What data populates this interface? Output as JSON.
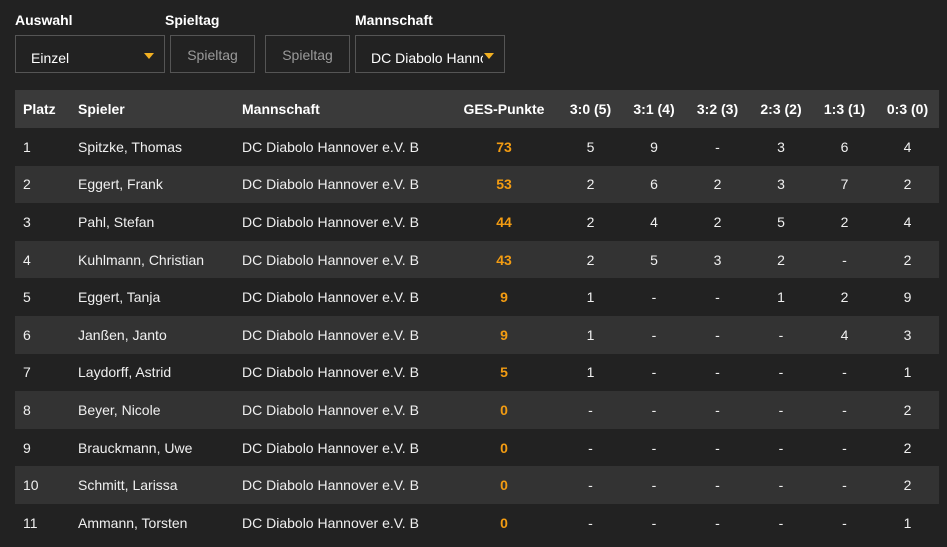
{
  "filters": {
    "auswahl_label": "Auswahl",
    "auswahl_value": "Einzel",
    "spieltag_label": "Spieltag",
    "spieltag_btn1": "Spieltag",
    "spieltag_btn2": "Spieltag",
    "mannschaft_label": "Mannschaft",
    "mannschaft_value": "DC Diabolo Hannover e.V. B"
  },
  "colors": {
    "accent": "#f39c12",
    "caret": "#f2b022",
    "header_bg": "#3a3a3a",
    "row_alt": "#333333",
    "bg": "#222222"
  },
  "table": {
    "headers": [
      "Platz",
      "Spieler",
      "Mannschaft",
      "GES-Punkte",
      "3:0 (5)",
      "3:1 (4)",
      "3:2 (3)",
      "2:3 (2)",
      "1:3 (1)",
      "0:3 (0)"
    ],
    "rows": [
      [
        "1",
        "Spitzke, Thomas",
        "DC Diabolo Hannover e.V. B",
        "73",
        "5",
        "9",
        "-",
        "3",
        "6",
        "4"
      ],
      [
        "2",
        "Eggert, Frank",
        "DC Diabolo Hannover e.V. B",
        "53",
        "2",
        "6",
        "2",
        "3",
        "7",
        "2"
      ],
      [
        "3",
        "Pahl, Stefan",
        "DC Diabolo Hannover e.V. B",
        "44",
        "2",
        "4",
        "2",
        "5",
        "2",
        "4"
      ],
      [
        "4",
        "Kuhlmann, Christian",
        "DC Diabolo Hannover e.V. B",
        "43",
        "2",
        "5",
        "3",
        "2",
        "-",
        "2"
      ],
      [
        "5",
        "Eggert, Tanja",
        "DC Diabolo Hannover e.V. B",
        "9",
        "1",
        "-",
        "-",
        "1",
        "2",
        "9"
      ],
      [
        "6",
        "Janßen, Janto",
        "DC Diabolo Hannover e.V. B",
        "9",
        "1",
        "-",
        "-",
        "-",
        "4",
        "3"
      ],
      [
        "7",
        "Laydorff, Astrid",
        "DC Diabolo Hannover e.V. B",
        "5",
        "1",
        "-",
        "-",
        "-",
        "-",
        "1"
      ],
      [
        "8",
        "Beyer, Nicole",
        "DC Diabolo Hannover e.V. B",
        "0",
        "-",
        "-",
        "-",
        "-",
        "-",
        "2"
      ],
      [
        "9",
        "Brauckmann, Uwe",
        "DC Diabolo Hannover e.V. B",
        "0",
        "-",
        "-",
        "-",
        "-",
        "-",
        "2"
      ],
      [
        "10",
        "Schmitt, Larissa",
        "DC Diabolo Hannover e.V. B",
        "0",
        "-",
        "-",
        "-",
        "-",
        "-",
        "2"
      ],
      [
        "11",
        "Ammann, Torsten",
        "DC Diabolo Hannover e.V. B",
        "0",
        "-",
        "-",
        "-",
        "-",
        "-",
        "1"
      ]
    ]
  }
}
